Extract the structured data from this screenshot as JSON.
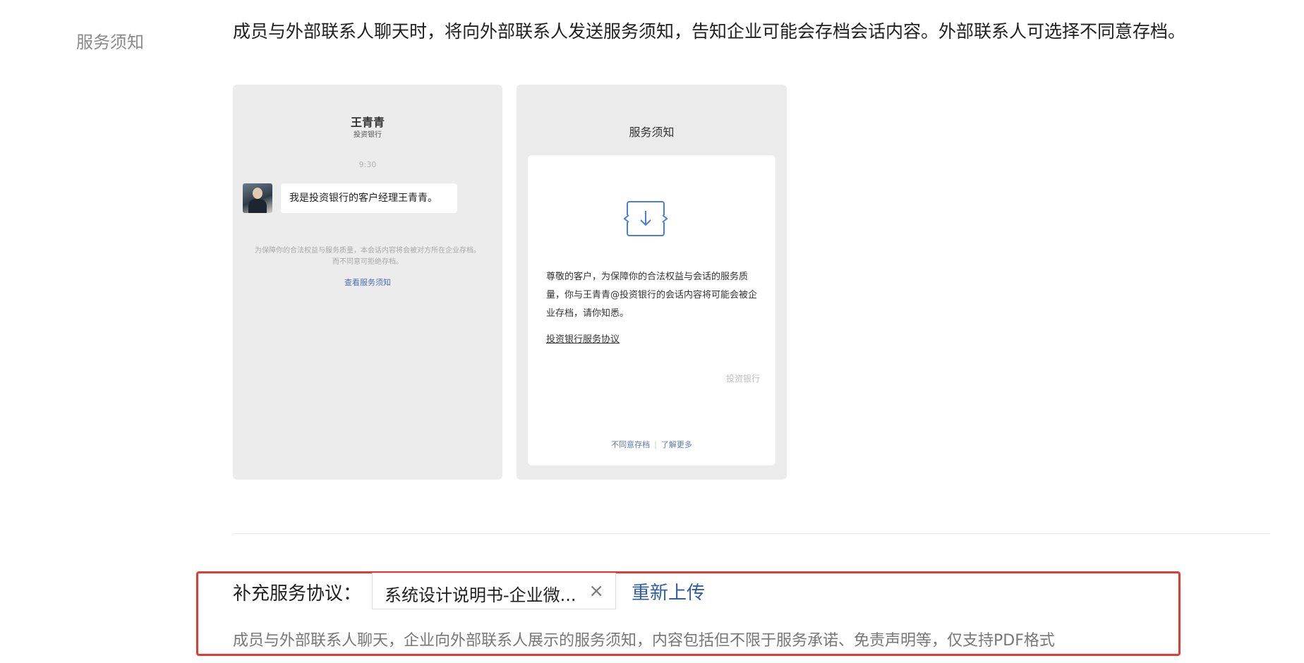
{
  "service_notice": {
    "label": "服务须知",
    "description": "成员与外部联系人聊天时，将向外部联系人发送服务须知，告知企业可能会存档会话内容。外部联系人可选择不同意存档。"
  },
  "preview_chat": {
    "name": "王青青",
    "company": "投资银行",
    "time": "9:30",
    "message": "我是投资银行的客户经理王青青。",
    "notice_text": "为保障你的合法权益与服务质量，本会话内容将会被对方所在企业存档。而不同意可拒绝存档。",
    "notice_link": "查看服务须知"
  },
  "preview_notice": {
    "title": "服务须知",
    "body": "尊敬的客户，为保障你的合法权益与会话的服务质量，你与王青青@投资银行的会话内容将可能会被企业存档，请你知悉。",
    "agreement_link": "投资银行服务协议",
    "brand": "投资银行",
    "footer_reject": "不同意存档",
    "footer_separator": "|",
    "footer_more": "了解更多",
    "icon": "download-doc-icon"
  },
  "supplement": {
    "label": "补充服务协议：",
    "file_name": "系统设计说明书-企业微...",
    "remove_icon": "close-icon",
    "reupload_label": "重新上传",
    "hint": "成员与外部联系人聊天，企业向外部联系人展示的服务须知，内容包括但不限于服务承诺、免责声明等，仅支持PDF格式"
  },
  "colors": {
    "highlight_border": "#e23b35",
    "link_blue": "#2f5da8"
  }
}
